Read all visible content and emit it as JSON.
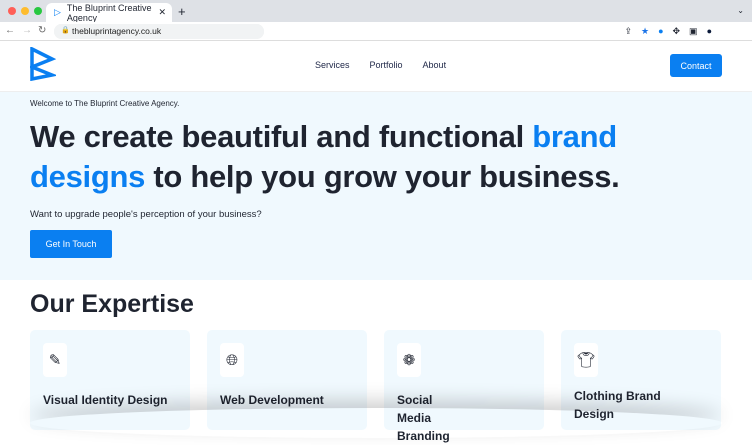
{
  "browser": {
    "tab_title": "The Bluprint Creative Agency",
    "url": "thebluprintagency.co.uk"
  },
  "header": {
    "menu": [
      "Services",
      "Portfolio",
      "About"
    ],
    "contact": "Contact"
  },
  "hero": {
    "welcome": "Welcome to The Bluprint Creative Agency.",
    "headline_a": "We create beautiful and functional ",
    "headline_b": "brand designs",
    "headline_c": " to help you grow your business.",
    "sub": "Want to upgrade people's perception of your business?",
    "cta": "Get In Touch"
  },
  "expertise": {
    "title": "Our Expertise",
    "cards": [
      {
        "title": "Visual Identity Design",
        "icon": "design-icon"
      },
      {
        "title": "Web Development",
        "icon": "globe-icon"
      },
      {
        "title": "Social Media Branding",
        "icon": "social-icon"
      },
      {
        "title": "Clothing Brand Design",
        "icon": "tshirt-icon"
      }
    ]
  },
  "colors": {
    "brand": "#0a7ff1",
    "hero_bg": "#f0f9fe"
  }
}
